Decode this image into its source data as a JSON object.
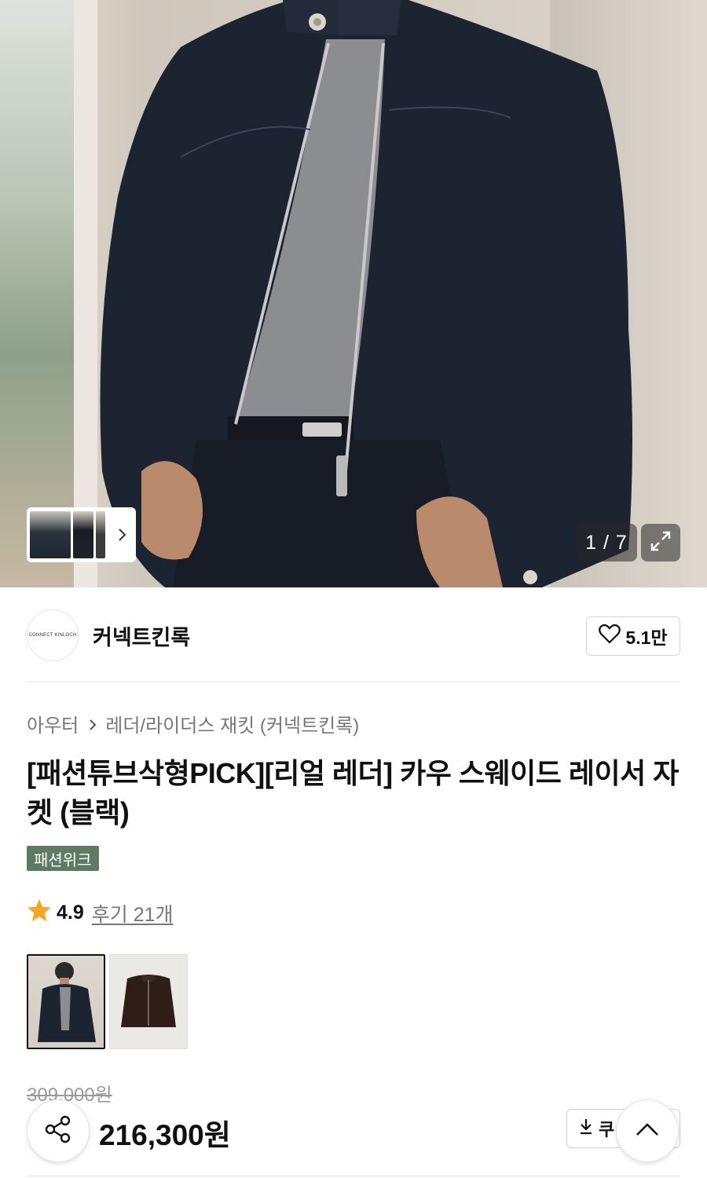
{
  "gallery": {
    "counter": "1 / 7"
  },
  "brand": {
    "logo_text": "CONNECT KINLOCH",
    "name": "커넥트킨록",
    "likes": "5.1만"
  },
  "breadcrumb": {
    "category": "아우터",
    "subcategory": "레더/라이더스 재킷 (커넥트킨록)"
  },
  "product": {
    "title": "[패션튜브삭형PICK][리얼 레더] 카우 스웨이드 레이서 자켓 (블랙)",
    "badge": "패션위크",
    "rating": "4.9",
    "reviews": "후기 21개",
    "original_price": "309,000원",
    "sale_price": "216,300원"
  },
  "actions": {
    "coupon_label": "쿠"
  },
  "colors": {
    "accent_badge": "#5d7a63",
    "star": "#f5a623"
  }
}
